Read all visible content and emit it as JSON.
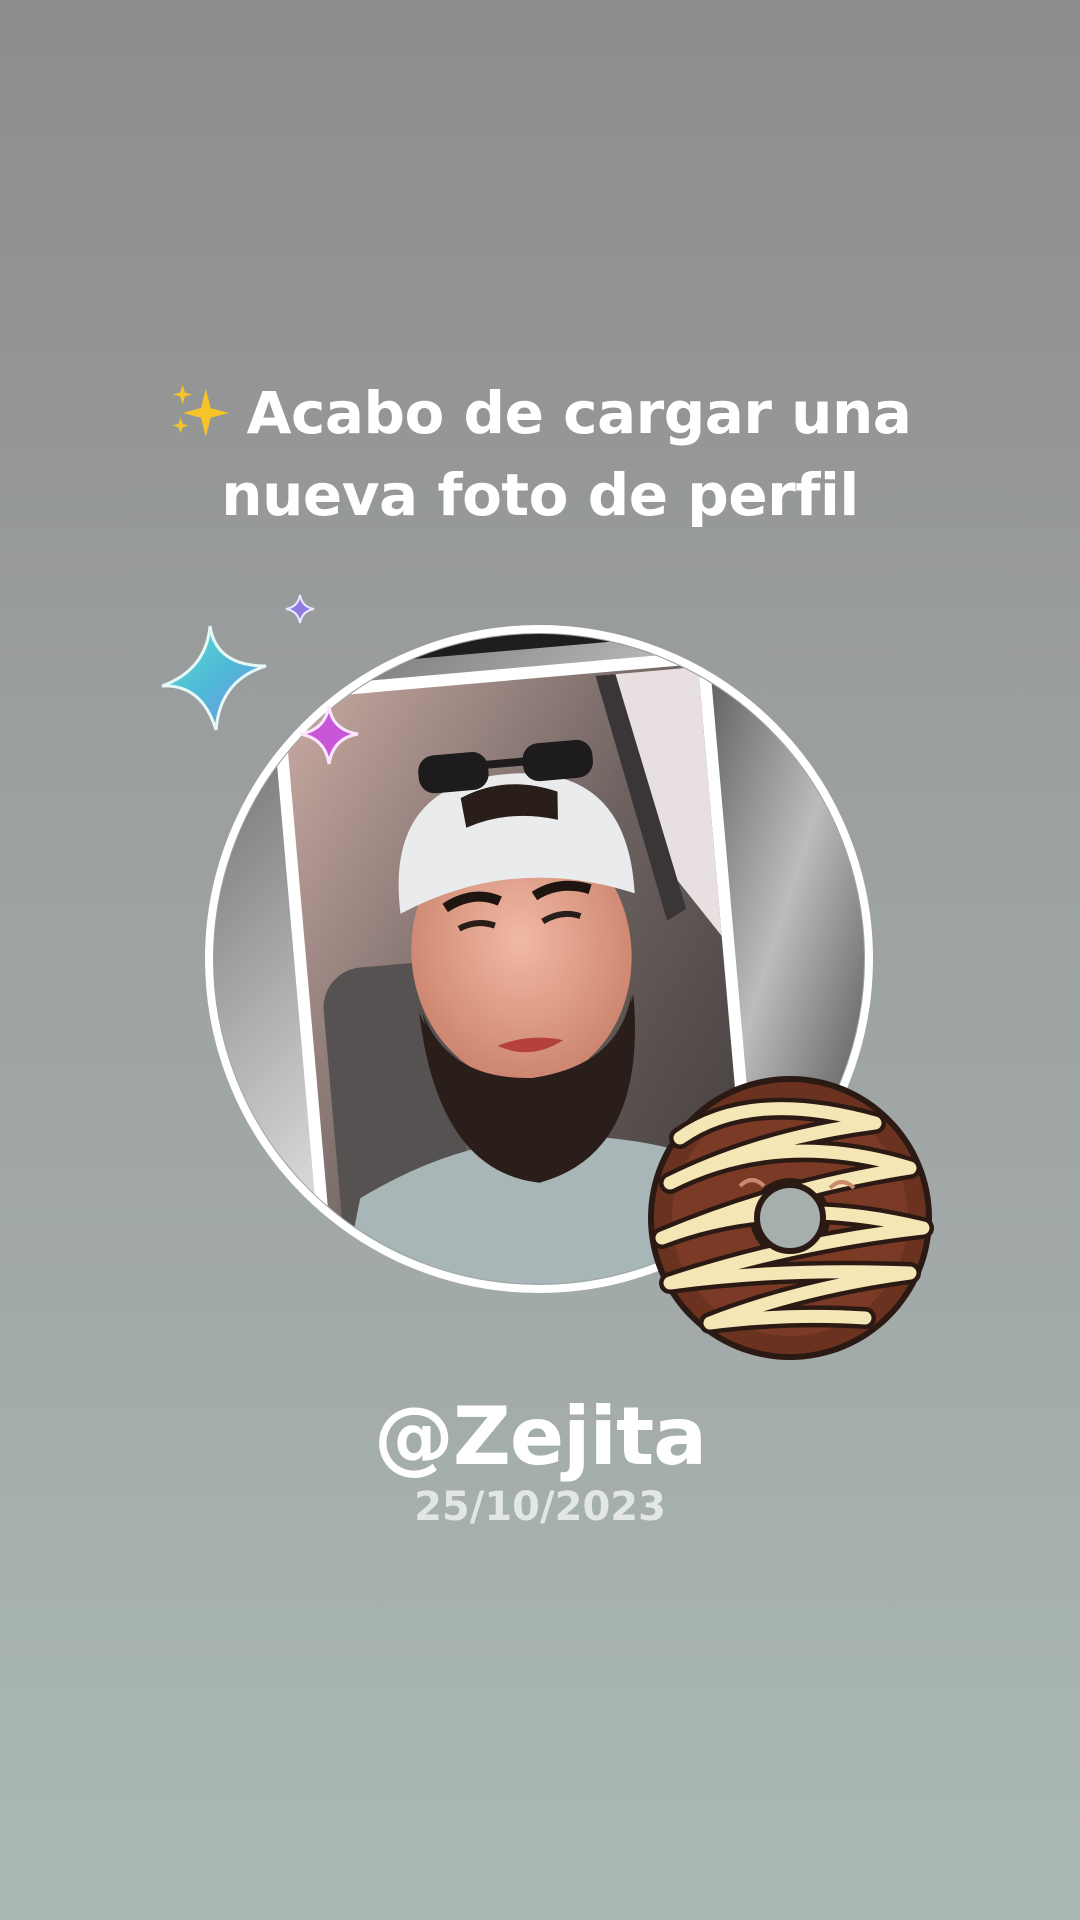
{
  "headline": {
    "emoji": "sparkles-icon",
    "line1": "Acabo de cargar una",
    "line2": "nueva foto de perfil"
  },
  "profile": {
    "photo": "profile-photo",
    "frame": "white-circle-frame"
  },
  "stickers": [
    "star-icon-teal",
    "star-icon-purple-small",
    "star-icon-magenta",
    "donut-sticker"
  ],
  "user": {
    "handle": "@Zejita",
    "date": "25/10/2023"
  },
  "colors": {
    "text": "#ffffff",
    "date_text": "#e3e6e6",
    "background_top": "#8c8c8c",
    "background_bottom": "#aab9b6"
  }
}
